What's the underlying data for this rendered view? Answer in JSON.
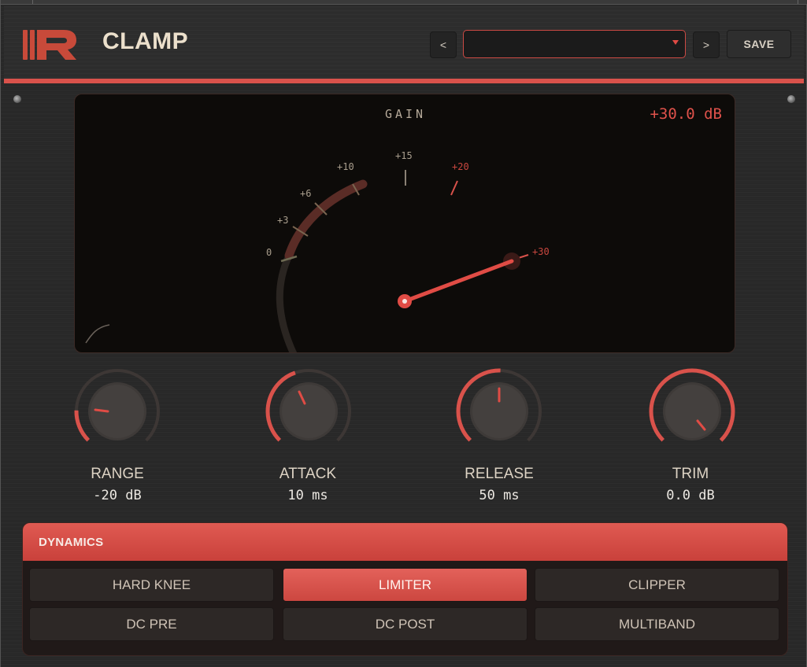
{
  "header": {
    "title": "CLAMP",
    "prev_label": "<",
    "next_label": ">",
    "save_label": "SAVE",
    "preset_value": ""
  },
  "meter": {
    "title": "GAIN",
    "readout": "+30.0 dB",
    "scale_labels": [
      "0",
      "+3",
      "+6",
      "+10",
      "+15",
      "+20",
      "+30"
    ]
  },
  "knobs": [
    {
      "label": "RANGE",
      "value": "-20 dB"
    },
    {
      "label": "ATTACK",
      "value": "10 ms"
    },
    {
      "label": "RELEASE",
      "value": "50 ms"
    },
    {
      "label": "TRIM",
      "value": "0.0 dB"
    }
  ],
  "dynamics": {
    "title": "DYNAMICS",
    "options": [
      "HARD KNEE",
      "LIMITER",
      "CLIPPER",
      "DC PRE",
      "DC POST",
      "MULTIBAND"
    ],
    "active": "LIMITER"
  },
  "colors": {
    "accent": "#d9524b",
    "background": "#2a2a2a",
    "meter_bg": "#0d0b09"
  }
}
